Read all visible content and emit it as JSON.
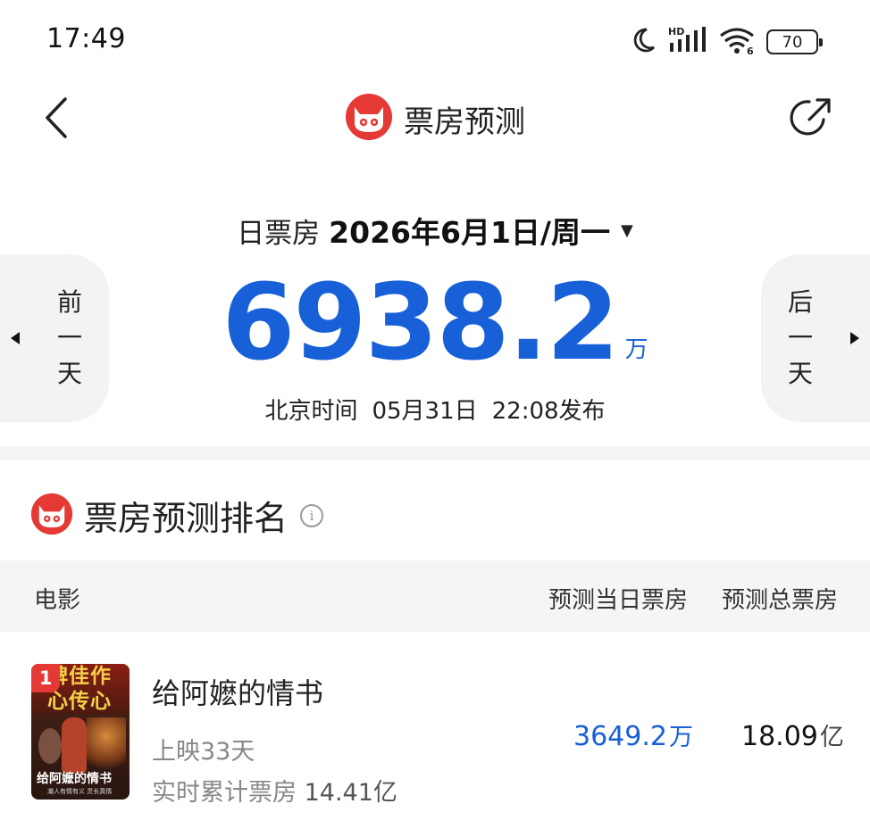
{
  "status_bar": {
    "time": "17:49",
    "battery": "70",
    "icons": [
      "moon-icon",
      "hd-signal-icon",
      "wifi-icon",
      "battery-icon"
    ]
  },
  "nav": {
    "title": "票房预测",
    "icons": [
      "back-icon",
      "maoyan-logo-icon",
      "share-icon"
    ]
  },
  "box_office": {
    "date_label": "日票房",
    "date_value": "2026年6月1日/周一",
    "prev_label": [
      "前",
      "一",
      "天"
    ],
    "next_label": [
      "后",
      "一",
      "天"
    ],
    "amount": "6938.2",
    "amount_unit": "万",
    "publish_prefix": "北京时间",
    "publish_date": "05月31日",
    "publish_time": "22:08发布"
  },
  "ranking": {
    "title": "票房预测排名",
    "columns": {
      "movie": "电影",
      "day": "预测当日票房",
      "total": "预测总票房"
    },
    "movies": [
      {
        "rank": "1",
        "title": "给阿嬷的情书",
        "days_label": "上映33天",
        "cum_label": "实时累计票房",
        "cum_value": "14.41亿",
        "day_value": "3649.2",
        "day_unit": "万",
        "total_value": "18.09",
        "total_unit": "亿",
        "poster_banner_1": "碑佳作",
        "poster_banner_2": "心传心",
        "poster_name": "给阿嬷的情书",
        "poster_tagline": "潮人有情有义 灵长真情"
      }
    ]
  },
  "colors": {
    "accent_blue": "#1760d8",
    "brand_red": "#e53935",
    "panel_gray": "#f3f3f3"
  }
}
